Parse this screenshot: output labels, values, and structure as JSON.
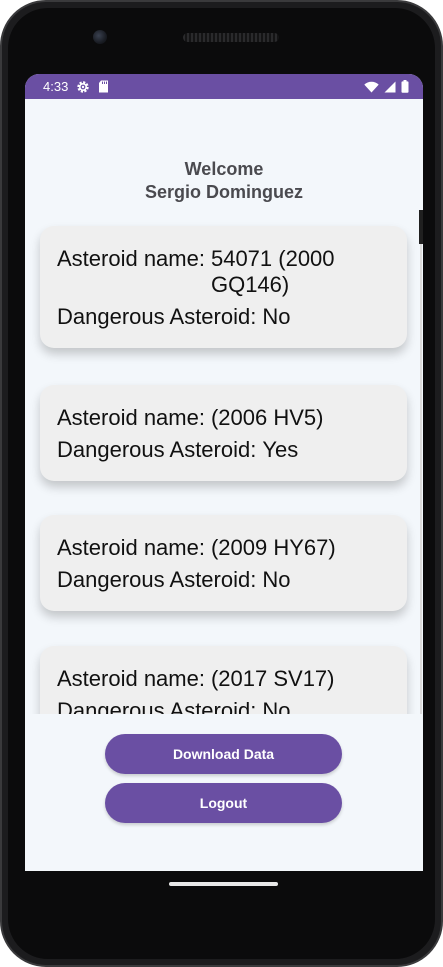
{
  "status_bar": {
    "time": "4:33"
  },
  "header": {
    "welcome": "Welcome",
    "user_name": "Sergio Dominguez"
  },
  "asteroids": [
    {
      "name_label": "Asteroid name:",
      "name": "54071 (2000 GQ146)",
      "danger_label": "Dangerous Asteroid:",
      "dangerous": "No"
    },
    {
      "name_label": "Asteroid name:",
      "name": "(2006 HV5)",
      "danger_label": "Dangerous Asteroid:",
      "dangerous": "Yes"
    },
    {
      "name_label": "Asteroid name:",
      "name": "(2009 HY67)",
      "danger_label": "Dangerous Asteroid:",
      "dangerous": "No"
    },
    {
      "name_label": "Asteroid name:",
      "name": "(2017 SV17)",
      "danger_label": "Dangerous Asteroid:",
      "dangerous": "No"
    }
  ],
  "actions": {
    "download_label": "Download Data",
    "logout_label": "Logout"
  },
  "colors": {
    "primary": "#6a4fa3",
    "background": "#f3f7fb",
    "card": "#efefef"
  }
}
